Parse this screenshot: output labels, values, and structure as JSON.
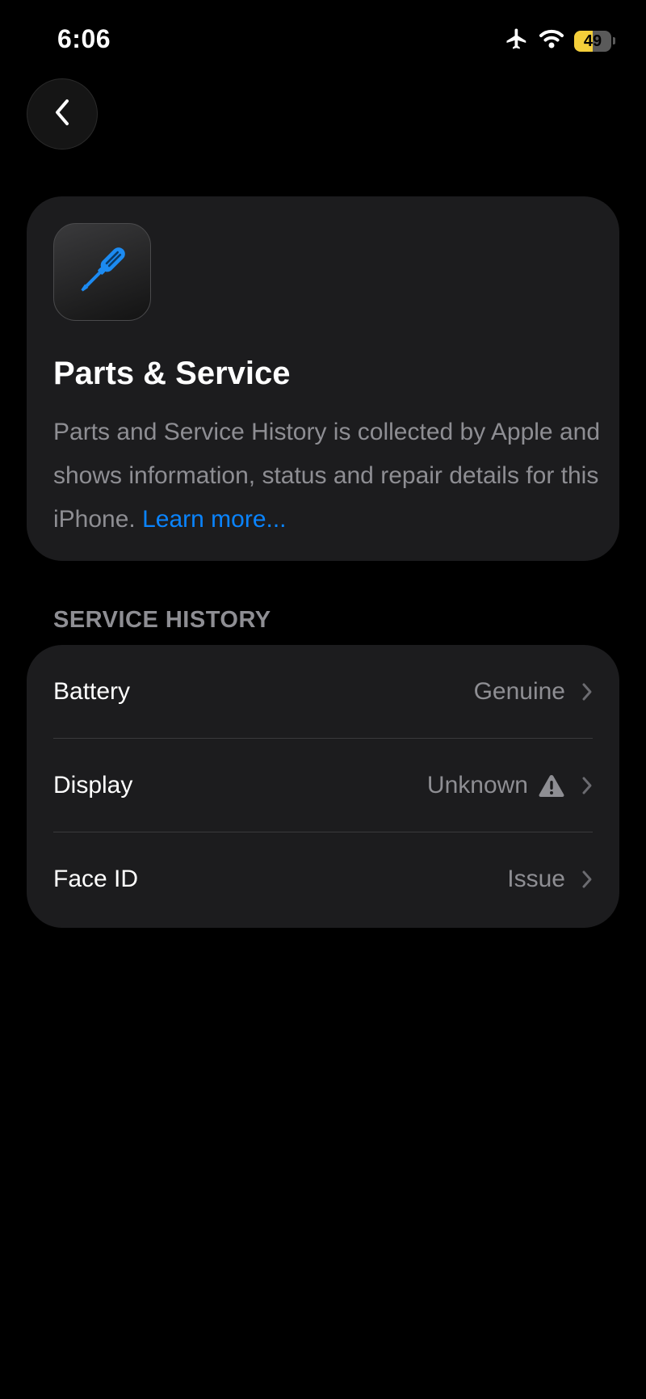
{
  "status_bar": {
    "time": "6:06",
    "battery_level": "49",
    "battery_fraction": 0.49,
    "battery_color": "#f4cf3a",
    "icons": [
      "airplane-icon",
      "wifi-icon",
      "battery-icon"
    ]
  },
  "back_icon": "chevron-left-icon",
  "header": {
    "icon": "screwdriver-icon",
    "icon_color": "#1c8bf2",
    "title": "Parts & Service",
    "description": "Parts and Service History is collected by Apple and shows information, status and repair details for this iPhone.",
    "link_label": "Learn more..."
  },
  "service_history": {
    "section_title": "SERVICE HISTORY",
    "rows": [
      {
        "label": "Battery",
        "value": "Genuine",
        "warning": false
      },
      {
        "label": "Display",
        "value": "Unknown",
        "warning": true
      },
      {
        "label": "Face ID",
        "value": "Issue",
        "warning": false
      }
    ]
  },
  "colors": {
    "background": "#000000",
    "card": "#1c1c1e",
    "secondary_text": "#8e8e93",
    "link": "#0a84ff"
  }
}
